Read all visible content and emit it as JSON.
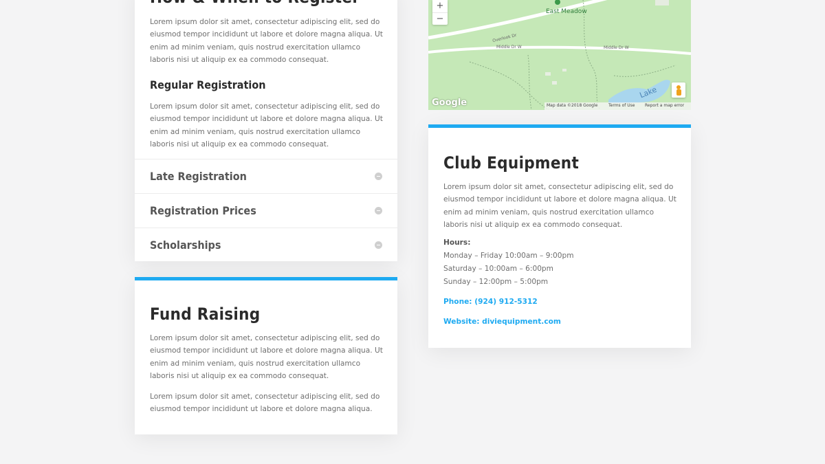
{
  "register": {
    "title": "How & When to Register",
    "intro": "Lorem ipsum dolor sit amet, consectetur adipiscing elit, sed do eiusmod tempor incididunt ut labore et dolore magna aliqua. Ut enim ad minim veniam, quis nostrud exercitation ullamco laboris nisi ut aliquip ex ea commodo consequat.",
    "regular_title": "Regular Registration",
    "regular_text": "Lorem ipsum dolor sit amet, consectetur adipiscing elit, sed do eiusmod tempor incididunt ut labore et dolore magna aliqua. Ut enim ad minim veniam, quis nostrud exercitation ullamco laboris nisi ut aliquip ex ea commodo consequat.",
    "toggles": [
      "Late Registration",
      "Registration Prices",
      "Scholarships"
    ]
  },
  "fund": {
    "title": "Fund Raising",
    "text1": "Lorem ipsum dolor sit amet, consectetur adipiscing elit, sed do eiusmod tempor incididunt ut labore et dolore magna aliqua. Ut enim ad minim veniam, quis nostrud exercitation ullamco laboris nisi ut aliquip ex ea commodo consequat.",
    "text2": "Lorem ipsum dolor sit amet, consectetur adipiscing elit, sed do eiusmod tempor incididunt ut labore et dolore magna aliqua."
  },
  "map": {
    "zoom_in": "+",
    "zoom_out": "−",
    "poi": "East Meadow",
    "road_overlook": "Overlook Dr",
    "road_middle_1": "Middle Dr W",
    "road_middle_2": "Middle Dr W",
    "lake": "Lake",
    "logo": "Google",
    "map_data": "Map data ©2018 Google",
    "terms": "Terms of Use",
    "report": "Report a map error"
  },
  "equipment": {
    "title": "Club Equipment",
    "text": "Lorem ipsum dolor sit amet, consectetur adipiscing elit, sed do eiusmod tempor incididunt ut labore et dolore magna aliqua. Ut enim ad minim veniam, quis nostrud exercitation ullamco laboris nisi ut aliquip ex ea commodo consequat.",
    "hours_label": "Hours:",
    "hours": [
      "Monday – Friday 10:00am – 9:00pm",
      "Saturday – 10:00am – 6:00pm",
      "Sunday – 12:00pm – 5:00pm"
    ],
    "phone": "Phone: (924) 912-5312",
    "website": "Website: diviequipment.com"
  },
  "colors": {
    "accent": "#1eaaf1",
    "map_green": "#c5e8b7",
    "background": "#f4f4f5"
  }
}
